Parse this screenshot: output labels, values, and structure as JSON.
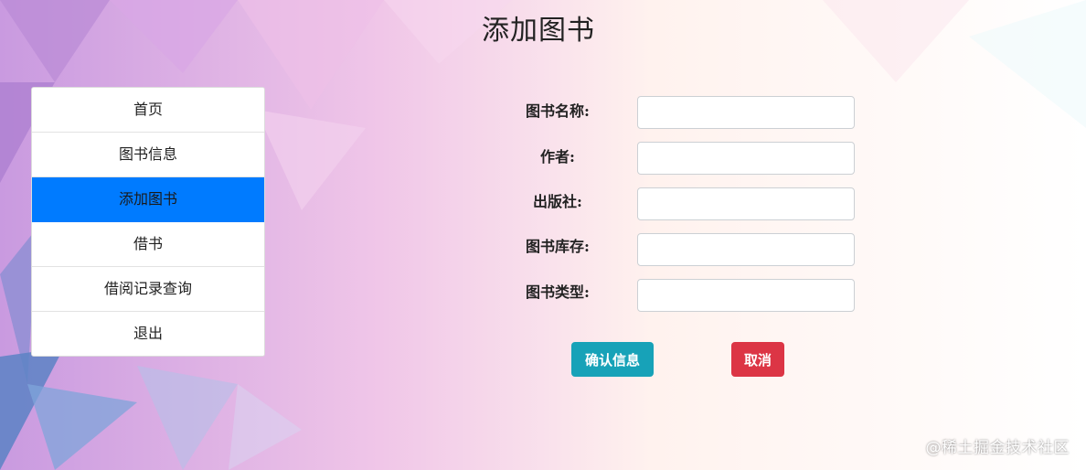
{
  "page": {
    "title": "添加图书"
  },
  "sidebar": {
    "items": [
      {
        "label": "首页",
        "active": false
      },
      {
        "label": "图书信息",
        "active": false
      },
      {
        "label": "添加图书",
        "active": true
      },
      {
        "label": "借书",
        "active": false
      },
      {
        "label": "借阅记录查询",
        "active": false
      },
      {
        "label": "退出",
        "active": false
      }
    ]
  },
  "form": {
    "fields": [
      {
        "label": "图书名称:",
        "value": ""
      },
      {
        "label": "作者:",
        "value": ""
      },
      {
        "label": "出版社:",
        "value": ""
      },
      {
        "label": "图书库存:",
        "value": ""
      },
      {
        "label": "图书类型:",
        "value": ""
      }
    ],
    "confirm_label": "确认信息",
    "cancel_label": "取消"
  },
  "watermark": "@稀土掘金技术社区",
  "colors": {
    "active_nav": "#007bff",
    "confirm_button": "#17a2b8",
    "cancel_button": "#dc3545"
  }
}
